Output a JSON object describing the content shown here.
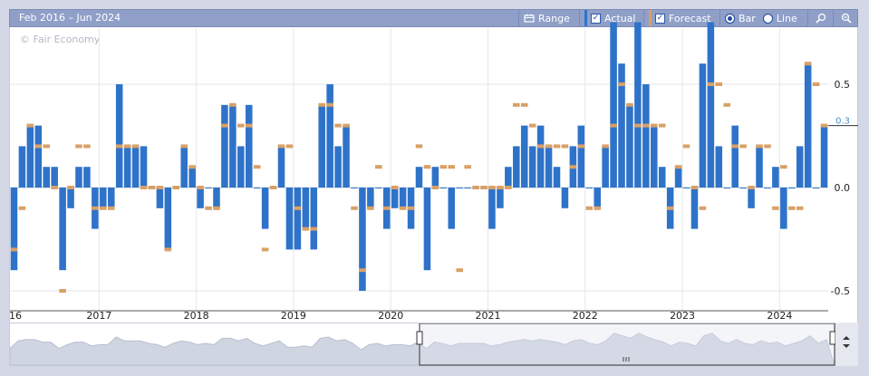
{
  "toolbar": {
    "range_text": "Feb 2016 – Jun 2024",
    "range_button": "Range",
    "actual_label": "Actual",
    "forecast_label": "Forecast",
    "bar_label": "Bar",
    "line_label": "Line",
    "selected_mode": "bar",
    "zoom_in_icon": "magnifier-icon",
    "zoom_out_icon": "zoom-out-icon"
  },
  "watermark": "© Fair Economy",
  "colors": {
    "actual": "#2e73c9",
    "forecast": "#d9a066",
    "toolbar": "#8f9fc8",
    "last_value_line": "#4a90c8"
  },
  "chart_data": {
    "type": "bar",
    "title": "",
    "xlabel": "",
    "ylabel": "",
    "ylim": [
      -0.5,
      0.5
    ],
    "y_ticks": [
      "0.5",
      "0.0",
      "-0.5"
    ],
    "y_tick_values": [
      0.5,
      0.0,
      -0.5
    ],
    "last_value_label": "0.3",
    "last_value": 0.3,
    "x_tick_labels": [
      "16",
      "2017",
      "2018",
      "2019",
      "2020",
      "2021",
      "2022",
      "2023",
      "2024"
    ],
    "x_tick_dates": [
      "2016-01",
      "2017-01",
      "2018-01",
      "2019-01",
      "2020-01",
      "2021-01",
      "2022-01",
      "2023-01",
      "2024-01"
    ],
    "legend_placement": "toolbar",
    "grid": true,
    "dates": [
      "2016-02",
      "2016-03",
      "2016-04",
      "2016-05",
      "2016-06",
      "2016-07",
      "2016-08",
      "2016-09",
      "2016-10",
      "2016-11",
      "2016-12",
      "2017-01",
      "2017-02",
      "2017-03",
      "2017-04",
      "2017-05",
      "2017-06",
      "2017-07",
      "2017-08",
      "2017-09",
      "2017-10",
      "2017-11",
      "2017-12",
      "2018-01",
      "2018-02",
      "2018-03",
      "2018-04",
      "2018-05",
      "2018-06",
      "2018-07",
      "2018-08",
      "2018-09",
      "2018-10",
      "2018-11",
      "2018-12",
      "2019-01",
      "2019-02",
      "2019-03",
      "2019-04",
      "2019-05",
      "2019-06",
      "2019-07",
      "2019-08",
      "2019-09",
      "2019-10",
      "2019-11",
      "2019-12",
      "2020-01",
      "2020-02",
      "2020-03",
      "2020-04",
      "2020-05",
      "2020-06",
      "2020-07",
      "2020-08",
      "2020-09",
      "2020-10",
      "2020-11",
      "2020-12",
      "2021-01",
      "2021-02",
      "2021-03",
      "2021-04",
      "2021-05",
      "2021-06",
      "2021-07",
      "2021-08",
      "2021-09",
      "2021-10",
      "2021-11",
      "2021-12",
      "2022-01",
      "2022-02",
      "2022-03",
      "2022-04",
      "2022-05",
      "2022-06",
      "2022-07",
      "2022-08",
      "2022-09",
      "2022-10",
      "2022-11",
      "2022-12",
      "2023-01",
      "2023-02",
      "2023-03",
      "2023-04",
      "2023-05",
      "2023-06",
      "2023-07",
      "2023-08",
      "2023-09",
      "2023-10",
      "2023-11",
      "2023-12",
      "2024-01",
      "2024-02",
      "2024-03",
      "2024-04",
      "2024-05",
      "2024-06"
    ],
    "series": [
      {
        "name": "Actual",
        "values": [
          -0.4,
          0.2,
          0.3,
          0.3,
          0.1,
          0.1,
          -0.4,
          -0.1,
          0.1,
          0.1,
          -0.2,
          -0.1,
          -0.1,
          0.5,
          0.2,
          0.2,
          0.2,
          0.0,
          -0.1,
          -0.3,
          0.0,
          0.2,
          0.1,
          -0.1,
          0.0,
          -0.1,
          0.4,
          0.4,
          0.2,
          0.4,
          0.0,
          -0.2,
          0.0,
          0.2,
          -0.3,
          -0.3,
          -0.2,
          -0.3,
          0.4,
          0.5,
          0.2,
          0.3,
          0.0,
          -0.5,
          -0.1,
          0.0,
          -0.2,
          -0.1,
          -0.1,
          -0.2,
          0.1,
          -0.4,
          0.1,
          0.0,
          -0.2,
          0.0,
          0.0,
          0.0,
          0.0,
          -0.2,
          -0.1,
          0.1,
          0.2,
          0.3,
          0.2,
          0.3,
          0.2,
          0.1,
          -0.1,
          0.2,
          0.3,
          0.0,
          -0.1,
          0.2,
          0.8,
          0.6,
          0.4,
          0.8,
          0.5,
          0.3,
          0.1,
          -0.2,
          0.1,
          0.0,
          -0.2,
          0.6,
          0.8,
          0.2,
          0.0,
          0.3,
          0.0,
          -0.1,
          0.2,
          0.0,
          0.1,
          -0.2,
          0.0,
          0.2,
          0.6,
          0.0,
          0.3
        ]
      },
      {
        "name": "Forecast",
        "values": [
          -0.3,
          -0.1,
          0.3,
          0.2,
          0.2,
          0.0,
          -0.5,
          0.0,
          0.2,
          0.2,
          -0.1,
          -0.1,
          -0.1,
          0.2,
          0.2,
          0.2,
          0.0,
          0.0,
          0.0,
          -0.3,
          0.0,
          0.2,
          0.1,
          0.0,
          -0.1,
          -0.1,
          0.3,
          0.4,
          0.3,
          0.3,
          0.1,
          -0.3,
          0.0,
          0.2,
          0.2,
          -0.1,
          -0.2,
          -0.2,
          0.4,
          0.4,
          0.3,
          0.3,
          -0.1,
          -0.4,
          -0.1,
          0.1,
          -0.1,
          0.0,
          -0.1,
          -0.1,
          0.2,
          0.1,
          0.0,
          0.1,
          0.1,
          -0.4,
          0.1,
          0.0,
          0.0,
          0.0,
          0.0,
          0.0,
          0.4,
          0.4,
          0.3,
          0.2,
          0.2,
          0.2,
          0.2,
          0.1,
          0.2,
          -0.1,
          -0.1,
          0.2,
          0.3,
          0.5,
          0.4,
          0.3,
          0.3,
          0.3,
          0.3,
          -0.1,
          0.1,
          0.2,
          0.0,
          -0.1,
          0.5,
          0.5,
          0.4,
          0.2,
          0.2,
          0.0,
          0.2,
          0.2,
          -0.1,
          0.1,
          -0.1,
          -0.1,
          0.6,
          0.5,
          0.3
        ]
      }
    ]
  }
}
